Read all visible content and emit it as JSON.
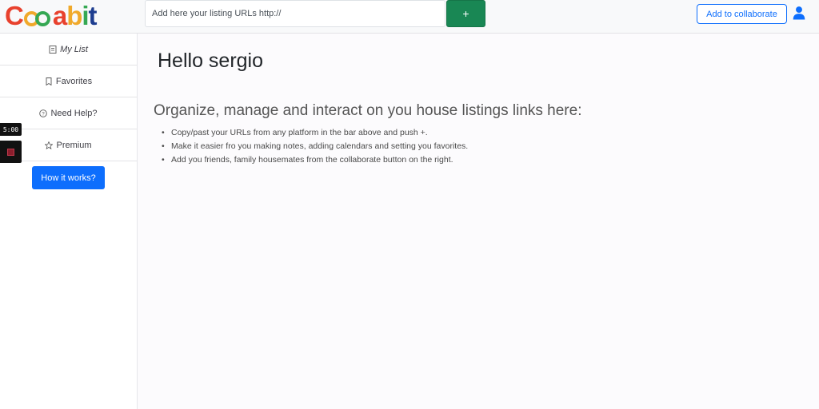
{
  "brand": {
    "logo_text": "Cooabit",
    "letters": [
      {
        "char": "C",
        "color": "#e8412d"
      },
      {
        "char": "o",
        "color": "#f0a92a"
      },
      {
        "char": "o",
        "color": "#35a853"
      },
      {
        "char": "a",
        "color": "#e8412d"
      },
      {
        "char": "b",
        "color": "#f0a92a"
      },
      {
        "char": "i",
        "color": "#35a853"
      },
      {
        "char": "t",
        "color": "#1d3d8f"
      }
    ]
  },
  "header": {
    "url_placeholder": "Add here your listing URLs http://",
    "add_label": "+",
    "collaborate_label": "Add to collaborate",
    "user_icon": "user-icon"
  },
  "sidebar": {
    "items": [
      {
        "label": "My List",
        "icon": "list-icon"
      },
      {
        "label": "Favorites",
        "icon": "bookmark-icon"
      },
      {
        "label": "Need Help?",
        "icon": "question-circle-icon"
      },
      {
        "label": "Premium",
        "icon": "star-icon"
      }
    ],
    "how_label": "How it works?"
  },
  "recorder": {
    "time": "5:00"
  },
  "main": {
    "greeting": "Hello sergio",
    "subheading": "Organize, manage and interact on you house listings links here:",
    "bullets": [
      "Copy/past your URLs from any platform in the bar above and push +.",
      "Make it easier fro you making notes, adding calendars and setting you favorites.",
      "Add you friends, family housemates from the collaborate button on the right."
    ]
  },
  "colors": {
    "primary": "#0d6efd",
    "success": "#198754",
    "background": "#fcfbfd"
  }
}
